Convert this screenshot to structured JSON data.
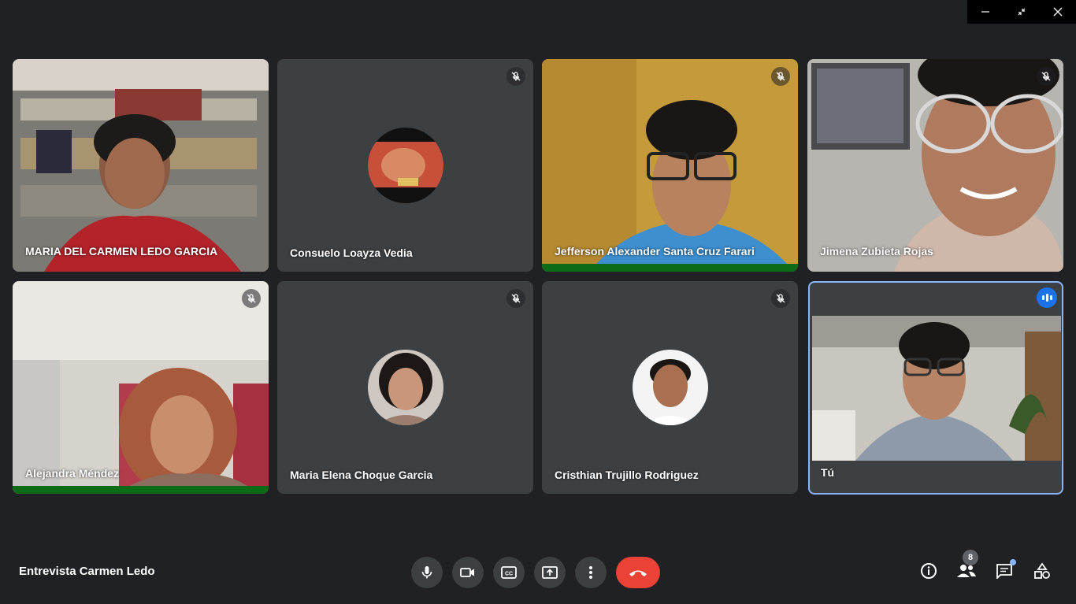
{
  "meeting": {
    "title": "Entrevista Carmen Ledo",
    "participant_count": "8"
  },
  "participants": [
    {
      "name": "MARIA DEL CARMEN LEDO GARCIA",
      "muted": false,
      "video": true
    },
    {
      "name": "Consuelo Loayza Vedia",
      "muted": true,
      "video": false
    },
    {
      "name": "Jefferson Alexander Santa Cruz Farari",
      "muted": true,
      "video": true
    },
    {
      "name": "Jimena Zubieta Rojas",
      "muted": true,
      "video": true
    },
    {
      "name": "Alejandra Méndez",
      "muted": true,
      "video": true
    },
    {
      "name": "Maria Elena Choque Garcia",
      "muted": true,
      "video": false
    },
    {
      "name": "Cristhian Trujillo Rodriguez",
      "muted": true,
      "video": false
    },
    {
      "name": "Tú",
      "muted": false,
      "video": true,
      "speaking": true
    }
  ],
  "controls": [
    "mic-icon",
    "camera-icon",
    "captions-icon",
    "present-icon",
    "more-icon",
    "end-call-icon"
  ],
  "right_controls": [
    "info-icon",
    "people-icon",
    "chat-icon",
    "activities-icon"
  ],
  "colors": {
    "background": "#202124",
    "tile": "#3c4043",
    "accent": "#8ab4f8",
    "end_call": "#ea4335",
    "active_speaker": "#0b6b16"
  }
}
